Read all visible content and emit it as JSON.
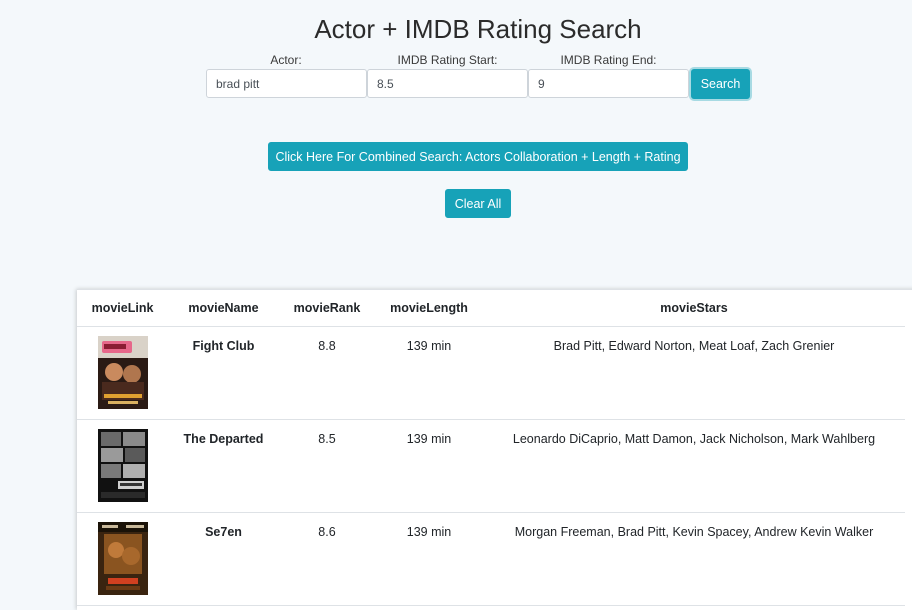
{
  "page": {
    "title": "Actor + IMDB Rating Search"
  },
  "search": {
    "actor_label": "Actor:",
    "actor_value": "brad pitt",
    "rating_start_label": "IMDB Rating Start:",
    "rating_start_value": "8.5",
    "rating_end_label": "IMDB Rating End:",
    "rating_end_value": "9",
    "search_button": "Search"
  },
  "buttons": {
    "combined_search": "Click Here For Combined Search: Actors Collaboration + Length + Rating",
    "clear_all": "Clear All"
  },
  "table": {
    "headers": [
      "movieLink",
      "movieName",
      "movieRank",
      "movieLength",
      "movieStars"
    ],
    "rows": [
      {
        "poster": "fight-club-poster",
        "name": "Fight Club",
        "rank": "8.8",
        "length": "139 min",
        "stars": "Brad Pitt, Edward Norton, Meat Loaf, Zach Grenier"
      },
      {
        "poster": "the-departed-poster",
        "name": "The Departed",
        "rank": "8.5",
        "length": "139 min",
        "stars": "Leonardo DiCaprio, Matt Damon, Jack Nicholson, Mark Wahlberg"
      },
      {
        "poster": "se7en-poster",
        "name": "Se7en",
        "rank": "8.6",
        "length": "139 min",
        "stars": "Morgan Freeman, Brad Pitt, Kevin Spacey, Andrew Kevin Walker"
      }
    ]
  },
  "colors": {
    "accent": "#17a2b8",
    "background": "#f4f8fb"
  }
}
